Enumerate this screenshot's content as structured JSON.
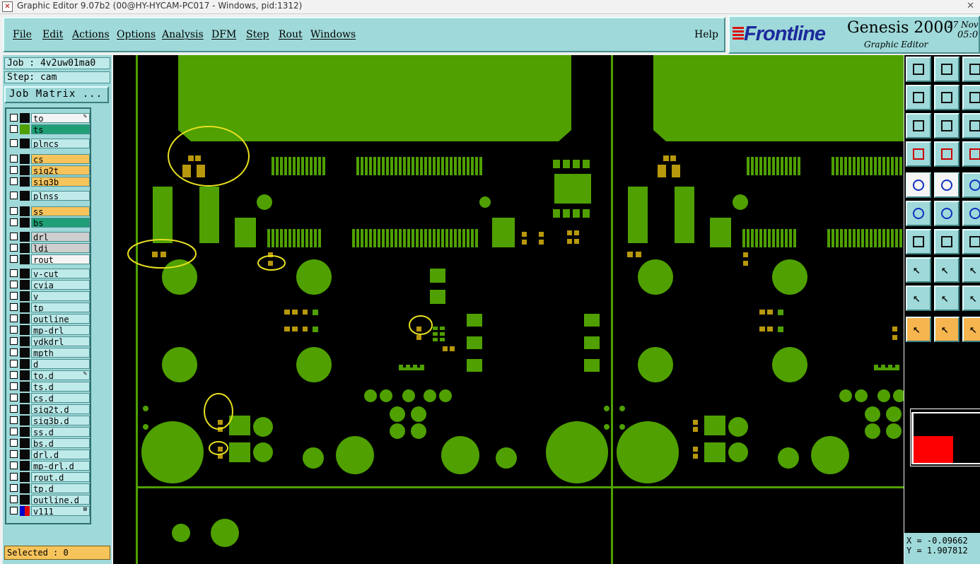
{
  "window": {
    "title": "Graphic Editor 9.07b2 (00@HY-HYCAM-PC017 - Windows, pid:1312)"
  },
  "menu": {
    "items": [
      "File",
      "Edit",
      "Actions",
      "Options",
      "Analysis",
      "DFM",
      "Step",
      "Rout",
      "Windows"
    ],
    "help": "Help"
  },
  "brand": {
    "logo": "Frontline",
    "product": "Genesis 2000",
    "subtitle": "Graphic Editor",
    "date": "27 Nov",
    "time": "05:0"
  },
  "job": {
    "job_label": "Job : 4v2uw01ma0",
    "step_label": "Step: cam",
    "matrix_button": "Job Matrix ..."
  },
  "layers": [
    {
      "name": "to",
      "style": "white",
      "swatch": "#0a0a0a",
      "mark": "✎"
    },
    {
      "name": "ts",
      "style": "green",
      "swatch": "#4fa000",
      "mark": ""
    },
    {
      "name": "plncs",
      "style": "",
      "swatch": "#0a0a0a",
      "mark": ""
    },
    {
      "name": "cs",
      "style": "orange",
      "swatch": "#0a0a0a",
      "mark": ""
    },
    {
      "name": "sig2t",
      "style": "orange",
      "swatch": "#0a0a0a",
      "mark": ""
    },
    {
      "name": "sig3b",
      "style": "orange",
      "swatch": "#0a0a0a",
      "mark": ""
    },
    {
      "name": "plnss",
      "style": "",
      "swatch": "#0a0a0a",
      "mark": ""
    },
    {
      "name": "ss",
      "style": "orange",
      "swatch": "#0a0a0a",
      "mark": ""
    },
    {
      "name": "bs",
      "style": "green",
      "swatch": "#0a0a0a",
      "mark": ""
    },
    {
      "name": "drl",
      "style": "gray",
      "swatch": "#0a0a0a",
      "mark": ""
    },
    {
      "name": "ldi",
      "style": "gray",
      "swatch": "#0a0a0a",
      "mark": ""
    },
    {
      "name": "rout",
      "style": "white",
      "swatch": "#0a0a0a",
      "mark": ""
    },
    {
      "name": "v-cut",
      "style": "",
      "swatch": "#0a0a0a",
      "mark": ""
    },
    {
      "name": "cvia",
      "style": "",
      "swatch": "#0a0a0a",
      "mark": ""
    },
    {
      "name": "v",
      "style": "",
      "swatch": "#0a0a0a",
      "mark": ""
    },
    {
      "name": "tp",
      "style": "",
      "swatch": "#0a0a0a",
      "mark": ""
    },
    {
      "name": "outline",
      "style": "",
      "swatch": "#0a0a0a",
      "mark": ""
    },
    {
      "name": "mp-drl",
      "style": "",
      "swatch": "#0a0a0a",
      "mark": ""
    },
    {
      "name": "ydkdrl",
      "style": "",
      "swatch": "#0a0a0a",
      "mark": ""
    },
    {
      "name": "mpth",
      "style": "",
      "swatch": "#0a0a0a",
      "mark": ""
    },
    {
      "name": "d",
      "style": "",
      "swatch": "#0a0a0a",
      "mark": ""
    },
    {
      "name": "to.d",
      "style": "",
      "swatch": "#0a0a0a",
      "mark": "✎"
    },
    {
      "name": "ts.d",
      "style": "",
      "swatch": "#0a0a0a",
      "mark": ""
    },
    {
      "name": "cs.d",
      "style": "",
      "swatch": "#0a0a0a",
      "mark": ""
    },
    {
      "name": "sig2t.d",
      "style": "",
      "swatch": "#0a0a0a",
      "mark": ""
    },
    {
      "name": "sig3b.d",
      "style": "",
      "swatch": "#0a0a0a",
      "mark": ""
    },
    {
      "name": "ss.d",
      "style": "",
      "swatch": "#0a0a0a",
      "mark": ""
    },
    {
      "name": "bs.d",
      "style": "",
      "swatch": "#0a0a0a",
      "mark": ""
    },
    {
      "name": "drl.d",
      "style": "",
      "swatch": "#0a0a0a",
      "mark": ""
    },
    {
      "name": "mp-drl.d",
      "style": "",
      "swatch": "#0a0a0a",
      "mark": ""
    },
    {
      "name": "rout.d",
      "style": "",
      "swatch": "#0a0a0a",
      "mark": ""
    },
    {
      "name": "tp.d",
      "style": "",
      "swatch": "#0a0a0a",
      "mark": ""
    },
    {
      "name": "outline.d",
      "style": "",
      "swatch": "#0a0a0a",
      "mark": ""
    },
    {
      "name": "v111",
      "style": "",
      "swatch": "#e00000",
      "mark": "⊞"
    }
  ],
  "status": {
    "selected": "Selected : 0"
  },
  "coords": {
    "x": "X = -0.09662",
    "y": "Y = 1.907812"
  },
  "colors": {
    "panel": "#9fd9d9",
    "pad_green": "#4fa000",
    "smd_gold": "#b8980c",
    "highlight": "#e8e020"
  },
  "tools": [
    "move-up",
    "move-down",
    "move-left",
    "move-right",
    "rotate",
    "flip",
    "fit-zoom",
    "zoom-area",
    "ratio",
    "measure",
    "snap",
    "grid-toggle",
    "select-window",
    "draw-line",
    "add-pad",
    "delete",
    "route",
    "edit-vertex",
    "line-a",
    "line-b",
    "arc",
    "pad-add",
    "cut",
    "polygon",
    "triangle-a",
    "triangle-b",
    "triangle-c",
    "pointer",
    "pointer-select",
    "pointer-circle"
  ]
}
